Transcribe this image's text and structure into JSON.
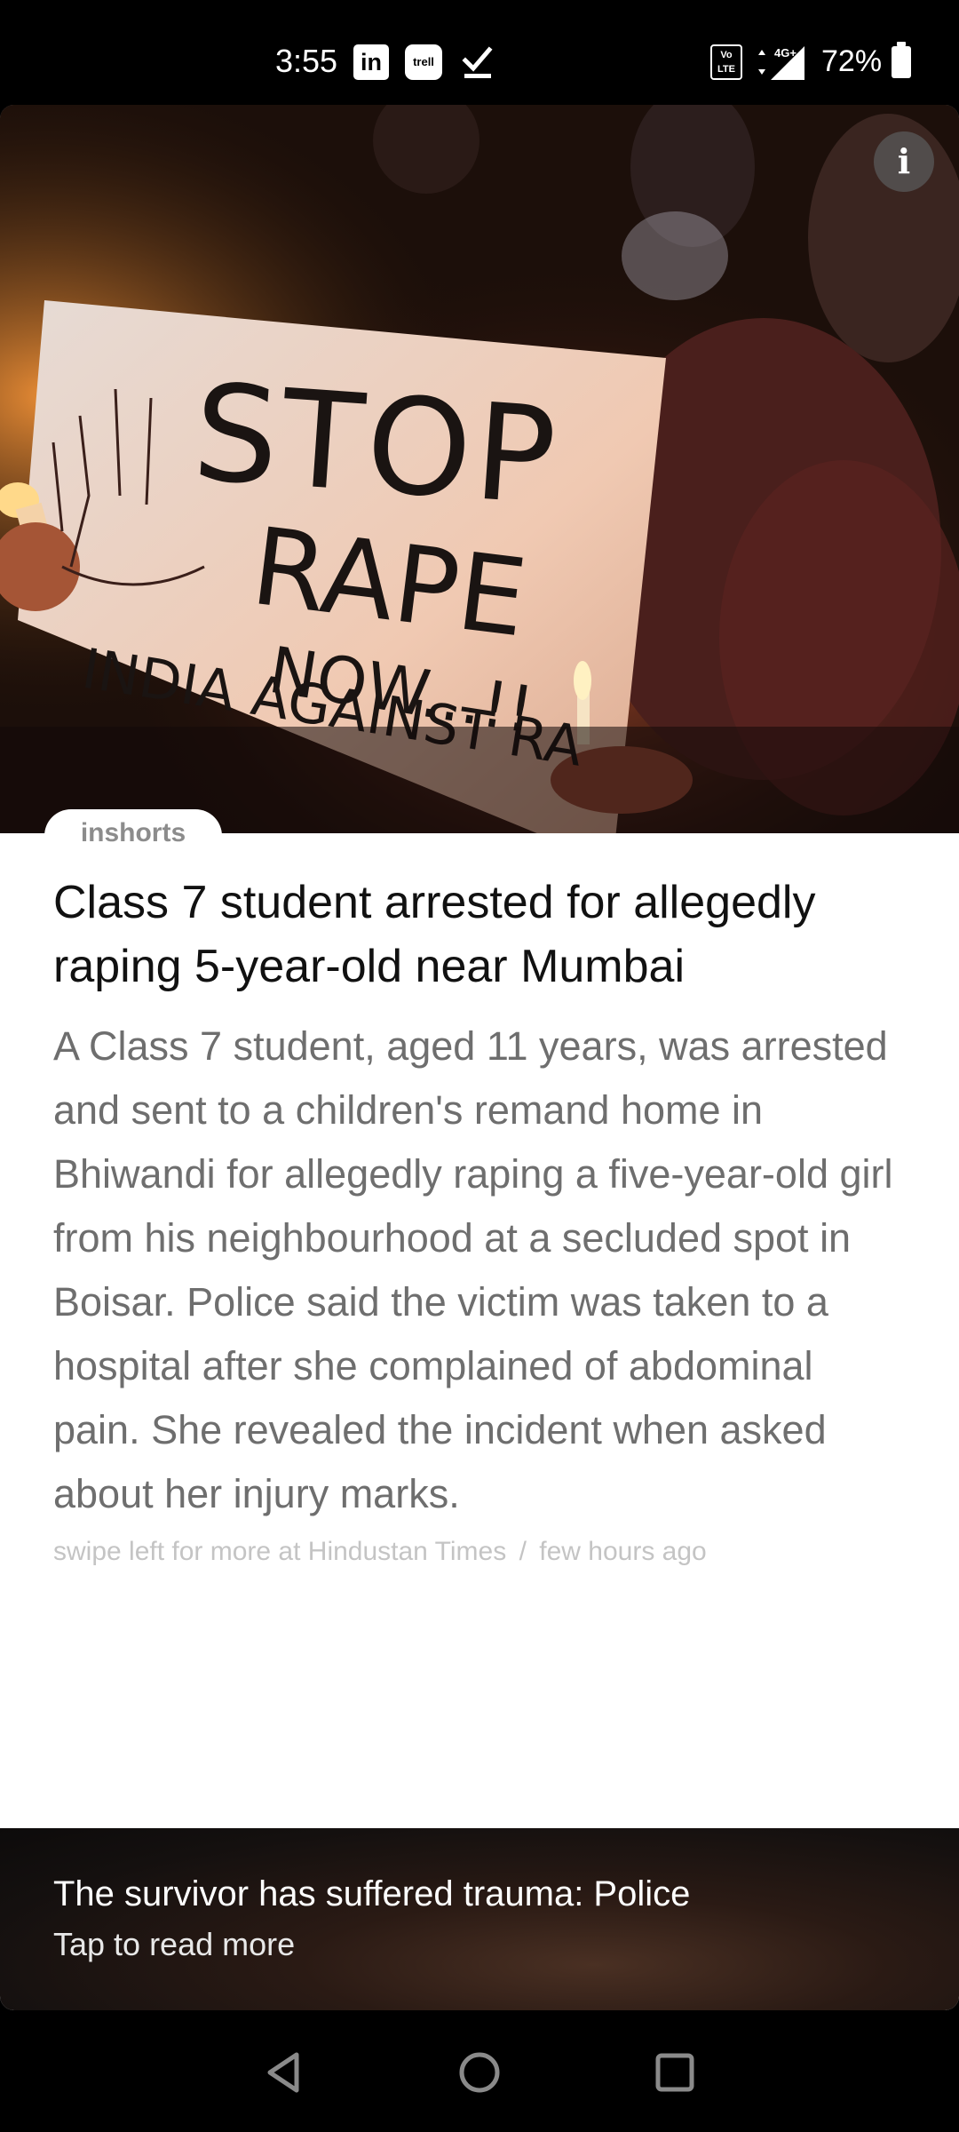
{
  "status_bar": {
    "time": "3:55",
    "linkedin_label": "in",
    "trell_label": "trell",
    "volte_label": "Vo LTE",
    "network_label": "4G+",
    "battery_percent": "72%",
    "icons": [
      "linkedin-icon",
      "trell-icon",
      "check-icon",
      "volte-icon",
      "signal-icon",
      "battery-icon"
    ]
  },
  "article": {
    "image_description_icon": "protest-photo",
    "info_label": "i",
    "source_tab": "inshorts",
    "headline": "Class 7 student arrested for allegedly raping 5-year-old near Mumbai",
    "summary": "A Class 7 student, aged 11 years, was arrested and sent to a children's remand home in Bhiwandi for allegedly raping a five-year-old girl from his neighbourhood at a secluded spot in Boisar. Police said the victim was taken to a hospital after she complained of abdominal pain. She revealed the incident when asked about her injury marks.",
    "footer_source": "swipe left for more at Hindustan Times",
    "footer_separator": "/",
    "footer_time": "few hours ago"
  },
  "read_more": {
    "title": "The survivor has suffered trauma: Police",
    "subtitle": "Tap to read more"
  },
  "nav_bar": {
    "buttons": [
      "back-icon",
      "home-icon",
      "recents-icon"
    ]
  },
  "colors": {
    "headline": "#111111",
    "summary": "#6e6e6e",
    "footer": "#c4c4c4",
    "source_tab_text": "#8c8c8c"
  }
}
